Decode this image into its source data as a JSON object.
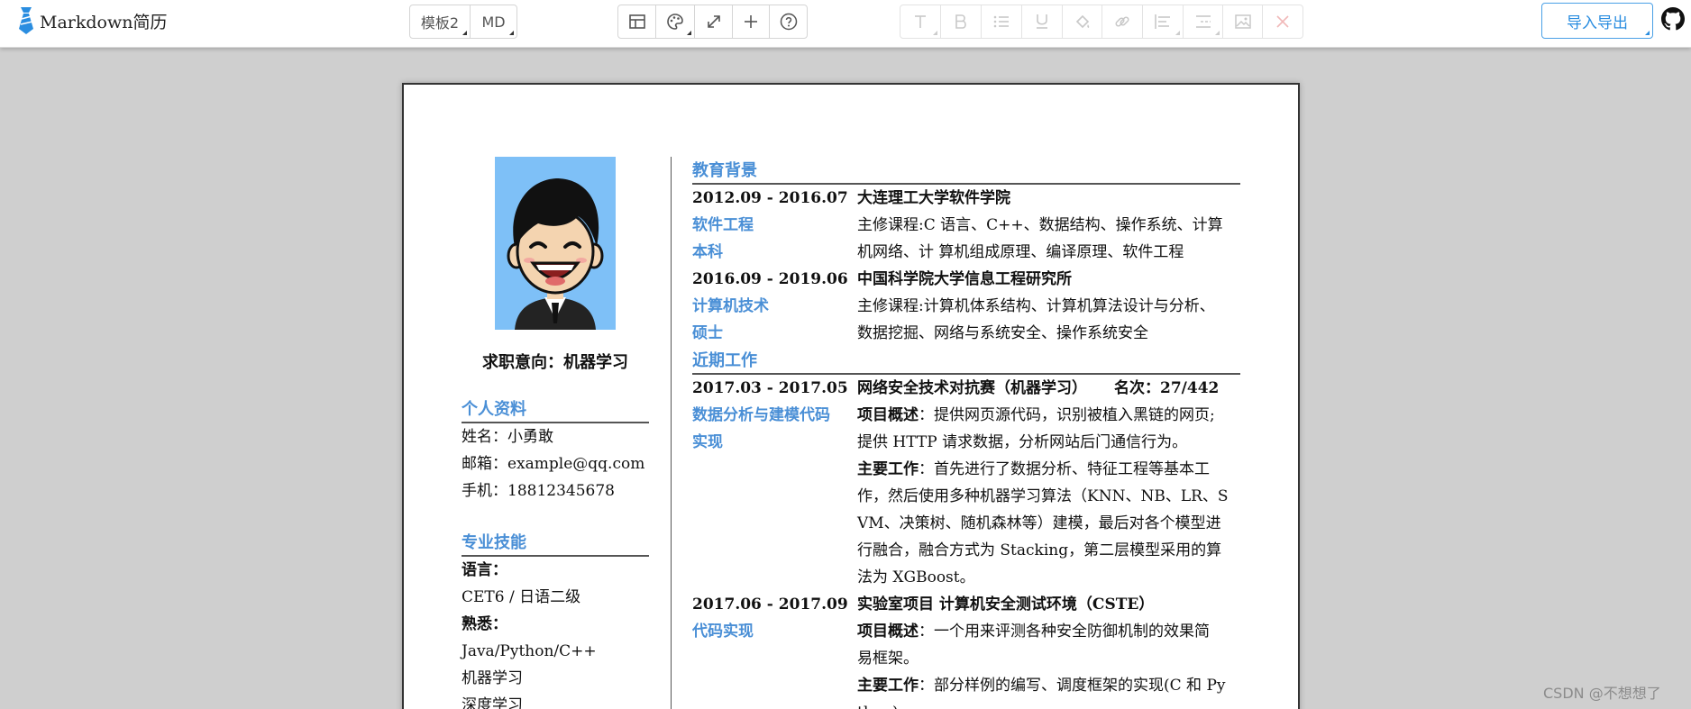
{
  "app": {
    "title": "Markdown简历",
    "logo_icon": "tie-icon"
  },
  "toolbar": {
    "template_label": "模板2",
    "md_label": "MD",
    "tool_icons": [
      "table-icon",
      "palette-icon",
      "expand-icon",
      "plus-icon",
      "help-icon"
    ],
    "format_icons": [
      "heading-icon",
      "bold-icon",
      "list-icon",
      "underline-icon",
      "fill-color-icon",
      "link-icon",
      "align-icon",
      "indent-icon",
      "image-icon",
      "close-icon"
    ],
    "import_label": "导入导出",
    "github_icon": "github-icon"
  },
  "colors": {
    "accent": "#4a8fd6",
    "button": "#2a8de0",
    "canvas": "#cfcfcf"
  },
  "resume": {
    "job_intention": "求职意向：机器学习",
    "profile": {
      "title": "个人资料",
      "name": "姓名：小勇敢",
      "email": "邮箱：example@qq.com",
      "phone": "手机：18812345678"
    },
    "skills": {
      "title": "专业技能",
      "lang_label": "语言：",
      "lang_value": "CET6 / 日语二级",
      "familiar_label": "熟悉：",
      "familiar_1": "Java/Python/C++",
      "familiar_2": "机器学习",
      "familiar_3": "深度学习"
    },
    "education": {
      "title": "教育背景",
      "entries": [
        {
          "date": "2012.09 - 2016.07",
          "school": "大连理工大学软件学院",
          "major": "软件工程",
          "degree": "本科",
          "course_1": "主修课程:C 语言、C++、数据结构、操作系统、计算",
          "course_2": "机网络、计 算机组成原理、编译原理、软件工程"
        },
        {
          "date": "2016.09 - 2019.06",
          "school": "中国科学院大学信息工程研究所",
          "major": "计算机技术",
          "degree": "硕士",
          "course_1": "主修课程:计算机体系结构、计算机算法设计与分析、",
          "course_2": "数据挖掘、网络与系统安全、操作系统安全"
        }
      ]
    },
    "work": {
      "title": "近期工作",
      "entries": [
        {
          "date": "2017.03 - 2017.05",
          "name": "网络安全技术对抗赛（机器学习）",
          "rank": "名次：27/442",
          "role_1": "数据分析与建模代码",
          "role_2": "实现",
          "overview_label": "项目概述",
          "overview_1": "：提供网页源代码，识别被植入黑链的网页;",
          "overview_2": "提供 HTTP 请求数据，分析网站后门通信行为。",
          "work_label": "主要工作",
          "work_1": "：首先进行了数据分析、特征工程等基本工",
          "work_2": "作，然后使用多种机器学习算法（KNN、NB、LR、S",
          "work_3": "VM、决策树、随机森林等）建模，最后对各个模型进",
          "work_4": "行融合，融合方式为 Stacking，第二层模型采用的算",
          "work_5": "法为 XGBoost。"
        },
        {
          "date": "2017.06 - 2017.09",
          "name": "实验室项目 计算机安全测试环境（CSTE）",
          "role_1": "代码实现",
          "overview_label": "项目概述",
          "overview_1": "：一个用来评测各种安全防御机制的效果简",
          "overview_2": "易框架。",
          "work_label": "主要工作",
          "work_1": "：部分样例的编写、调度框架的实现(C 和 Py",
          "work_2": "thon)。"
        }
      ]
    }
  },
  "watermark": "CSDN @不想想了"
}
